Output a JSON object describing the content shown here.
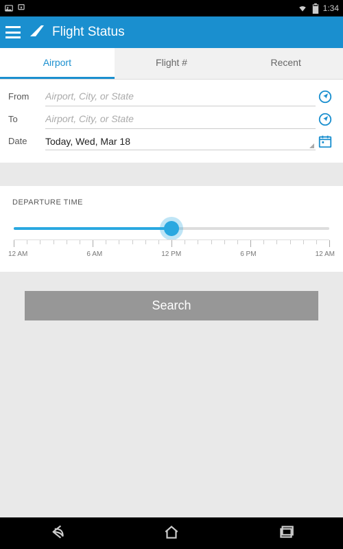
{
  "status": {
    "time": "1:34"
  },
  "header": {
    "title": "Flight Status"
  },
  "tabs": [
    {
      "label": "Airport",
      "active": true
    },
    {
      "label": "Flight #",
      "active": false
    },
    {
      "label": "Recent",
      "active": false
    }
  ],
  "form": {
    "from_label": "From",
    "from_placeholder": "Airport, City, or State",
    "to_label": "To",
    "to_placeholder": "Airport, City, or State",
    "date_label": "Date",
    "date_value": "Today, Wed, Mar 18"
  },
  "departure": {
    "title": "DEPARTURE TIME",
    "slider_percent": 50,
    "axis_labels": [
      "12 AM",
      "6 AM",
      "12 PM",
      "6 PM",
      "12 AM"
    ]
  },
  "search_label": "Search"
}
